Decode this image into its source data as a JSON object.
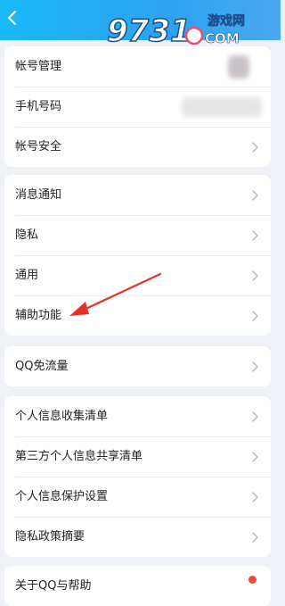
{
  "header": {
    "back_icon": "chevron-left-icon",
    "watermark_text": "9731",
    "watermark_site": "游戏网",
    "watermark_domain": "COM",
    "background_color": "#2aa8f2"
  },
  "groups": [
    {
      "rows": [
        {
          "label": "帐号管理",
          "chevron": false
        },
        {
          "label": "手机号码",
          "chevron": false
        },
        {
          "label": "帐号安全",
          "chevron": true
        }
      ]
    },
    {
      "rows": [
        {
          "label": "消息通知",
          "chevron": true
        },
        {
          "label": "隐私",
          "chevron": true
        },
        {
          "label": "通用",
          "chevron": true
        },
        {
          "label": "辅助功能",
          "chevron": true
        }
      ]
    },
    {
      "rows": [
        {
          "label": "QQ免流量",
          "chevron": true
        }
      ]
    },
    {
      "rows": [
        {
          "label": "个人信息收集清单",
          "chevron": true
        },
        {
          "label": "第三方个人信息共享清单",
          "chevron": true
        },
        {
          "label": "个人信息保护设置",
          "chevron": true
        },
        {
          "label": "隐私政策摘要",
          "chevron": true
        }
      ]
    },
    {
      "rows": [
        {
          "label": "关于QQ与帮助",
          "chevron": false,
          "badge": "red-dot"
        }
      ]
    }
  ],
  "annotation": {
    "arrow_color": "#e8302a",
    "points_to": "辅助功能"
  }
}
